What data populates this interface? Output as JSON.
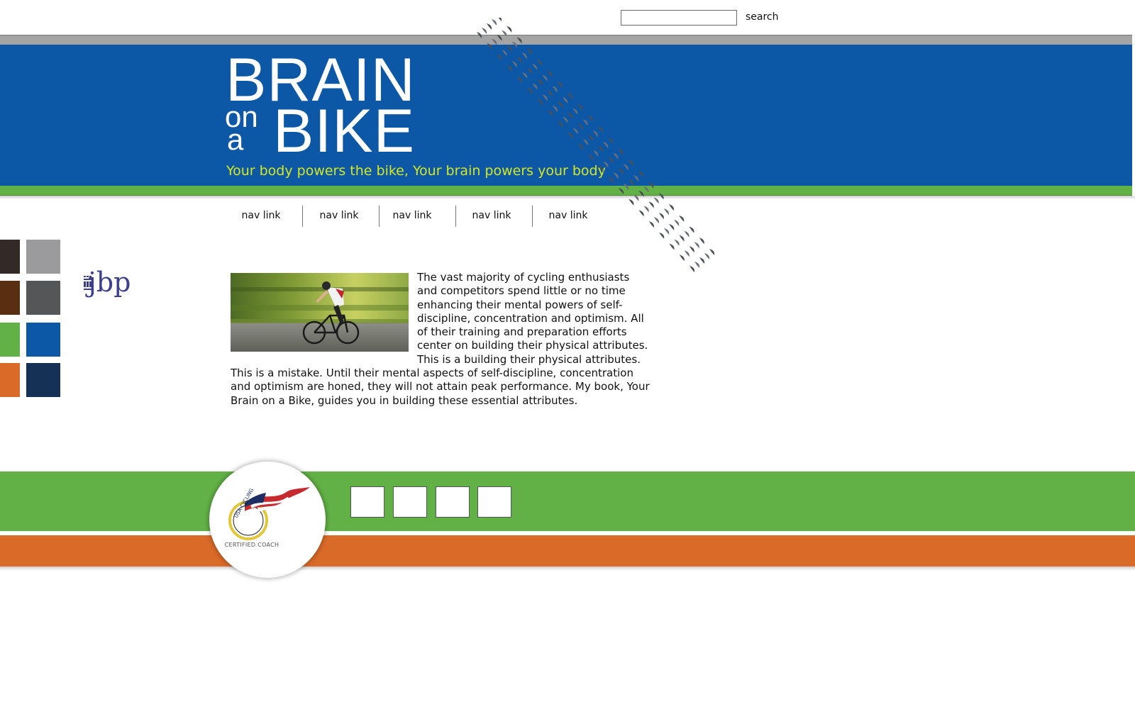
{
  "search": {
    "placeholder": "",
    "value": "",
    "button_label": "search"
  },
  "header": {
    "logo": {
      "line1": "BRAIN",
      "small_on": "on",
      "small_a": "a",
      "line2": "BIKE"
    },
    "tagline": "Your body powers the bike, Your brain powers your body"
  },
  "nav": {
    "items": [
      {
        "label": "nav link"
      },
      {
        "label": "nav link"
      },
      {
        "label": "nav link"
      },
      {
        "label": "nav link"
      },
      {
        "label": "nav link"
      }
    ]
  },
  "swatches": [
    "#332a28",
    "#9b9b9d",
    "#582f11",
    "#545658",
    "#62b146",
    "#0c58a6",
    "#d96a28",
    "#153256"
  ],
  "jbp_logo": {
    "text": "jbp"
  },
  "content": {
    "photo_alt": "cyclist",
    "body": "The vast majority of cycling enthusiasts and competitors spend little or no time enhancing their mental powers of self-discipline, concentration and optimism. All of their training and preparation efforts center on building their physical attributes. This is a building their physical attributes. This is a mistake. Until their mental aspects of self-discipline, concentration and optimism are honed, they will not attain peak performance. My book, Your Brain on a Bike, guides you in building these essential attributes."
  },
  "footer": {
    "badge": {
      "ring_text": "USA CYCLING",
      "caption": "CERTIFIED COACH"
    },
    "social_boxes": 4
  },
  "colors": {
    "header_blue": "#0c58a6",
    "accent_green": "#62b146",
    "accent_orange": "#d96a28",
    "tagline": "#d3e821"
  }
}
